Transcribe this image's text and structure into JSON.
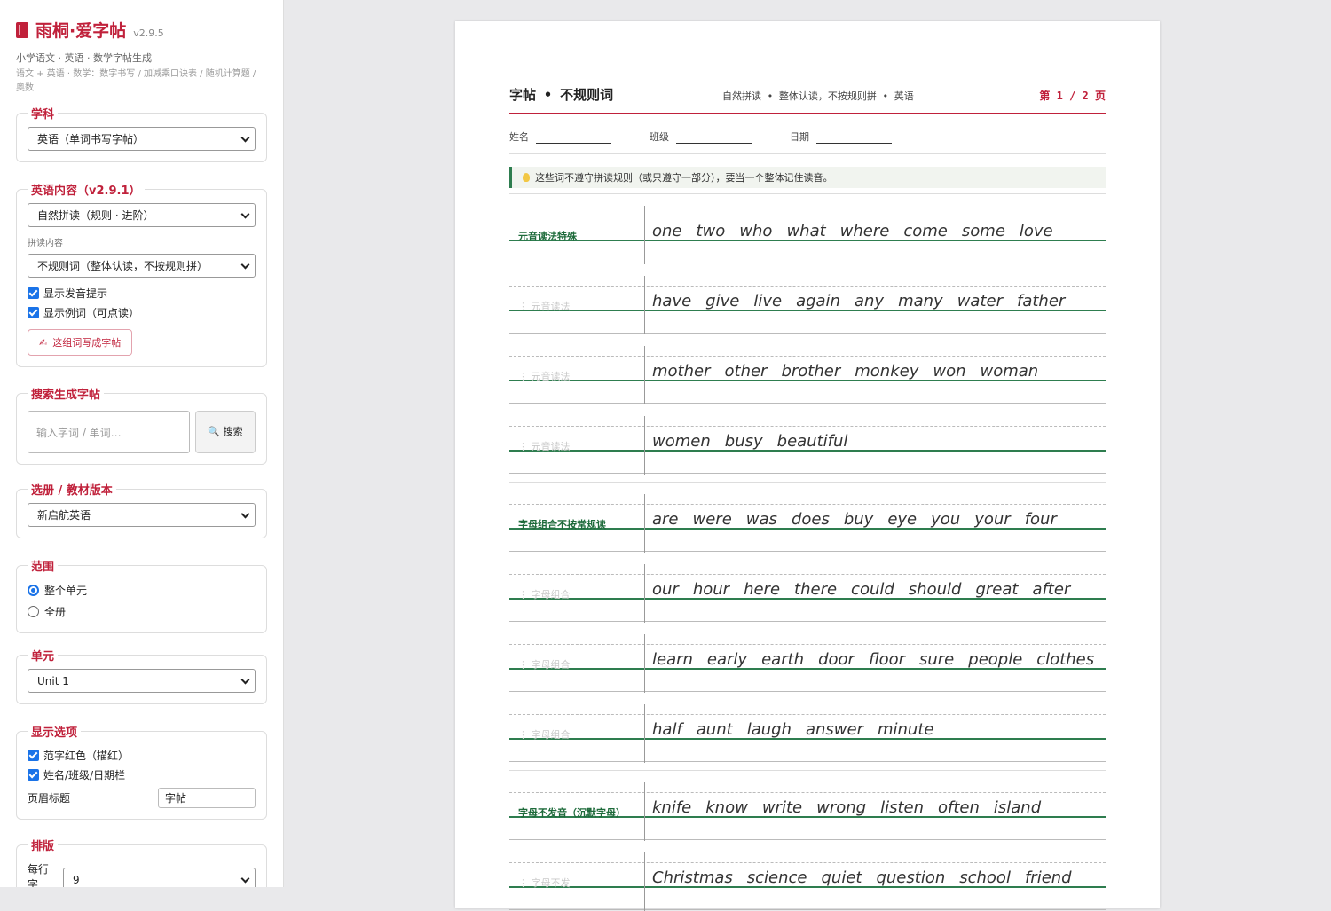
{
  "app": {
    "title": "雨桐·爱字帖",
    "version": "v2.9.5",
    "subtitle": "小学语文 · 英语 · 数学字帖生成",
    "subtitle2": "语文 + 英语 · 数学：数字书写 / 加减乘口诀表 / 随机计算题 / 奥数"
  },
  "sidebar": {
    "subject": {
      "legend": "学科",
      "value": "英语（单词书写字帖）"
    },
    "english": {
      "legend": "英语内容（v2.9.1）",
      "mode_value": "自然拼读（规则 · 进阶）",
      "reading_label": "拼读内容",
      "reading_value": "不规则词（整体认读，不按规则拼）",
      "show_phonics": "显示发音提示",
      "show_examples": "显示例词（可点读）",
      "write_button": "这组词写成字帖"
    },
    "search": {
      "legend": "搜索生成字帖",
      "placeholder": "输入字词 / 单词…",
      "button": "搜索"
    },
    "textbook": {
      "legend": "选册 / 教材版本",
      "value": "新启航英语"
    },
    "scope": {
      "legend": "范围",
      "options": [
        "整个单元",
        "全册"
      ],
      "selected": "整个单元"
    },
    "unit": {
      "legend": "单元",
      "value": "Unit 1"
    },
    "display": {
      "legend": "显示选项",
      "red_template": "范字红色（描红）",
      "name_bar": "姓名/班级/日期栏",
      "header_label": "页眉标题",
      "header_value": "字帖"
    },
    "layout": {
      "legend": "排版",
      "per_row_label": "每行字",
      "per_row_value": "9"
    }
  },
  "paper": {
    "title": "字帖  •  不规则词",
    "subtitle": "自然拼读 • 整体认读，不按规则拼 • 英语",
    "page": "第 1 / 2 页",
    "name_label": "姓名",
    "class_label": "班级",
    "date_label": "日期",
    "tip": "这些词不遵守拼读规则（或只遵守一部分），要当一个整体记住读音。",
    "rows": [
      {
        "category": "元音读法特殊",
        "faint": false,
        "words": [
          "one",
          "two",
          "who",
          "what",
          "where",
          "come",
          "some",
          "love"
        ]
      },
      {
        "category": "元音读法",
        "faint": true,
        "words": [
          "have",
          "give",
          "live",
          "again",
          "any",
          "many",
          "water",
          "father"
        ]
      },
      {
        "category": "元音读法",
        "faint": true,
        "words": [
          "mother",
          "other",
          "brother",
          "monkey",
          "won",
          "woman"
        ]
      },
      {
        "category": "元音读法",
        "faint": true,
        "words": [
          "women",
          "busy",
          "beautiful"
        ]
      },
      {
        "category": "字母组合不按常规读",
        "faint": false,
        "words": [
          "are",
          "were",
          "was",
          "does",
          "buy",
          "eye",
          "you",
          "your",
          "four"
        ]
      },
      {
        "category": "字母组合",
        "faint": true,
        "words": [
          "our",
          "hour",
          "here",
          "there",
          "could",
          "should",
          "great",
          "after"
        ]
      },
      {
        "category": "字母组合",
        "faint": true,
        "words": [
          "learn",
          "early",
          "earth",
          "door",
          "floor",
          "sure",
          "people",
          "clothes"
        ]
      },
      {
        "category": "字母组合",
        "faint": true,
        "words": [
          "half",
          "aunt",
          "laugh",
          "answer",
          "minute"
        ]
      },
      {
        "category": "字母不发音（沉默字母）",
        "faint": false,
        "words": [
          "knife",
          "know",
          "write",
          "wrong",
          "listen",
          "often",
          "island"
        ]
      },
      {
        "category": "字母不发",
        "faint": true,
        "words": [
          "Christmas",
          "science",
          "quiet",
          "question",
          "school",
          "friend"
        ]
      }
    ]
  }
}
